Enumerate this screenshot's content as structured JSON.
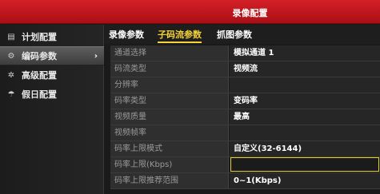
{
  "window": {
    "title": "录像配置"
  },
  "sidebar": {
    "items": [
      {
        "label": "计划配置",
        "icon": "calendar-icon",
        "glyph": "▤"
      },
      {
        "label": "编码参数",
        "icon": "gear-icon",
        "glyph": "⚙",
        "arrow": "›",
        "active": true
      },
      {
        "label": "高级配置",
        "icon": "settings-icon",
        "glyph": "✲"
      },
      {
        "label": "假日配置",
        "icon": "umbrella-icon",
        "glyph": "☂"
      }
    ]
  },
  "tabs": [
    {
      "label": "录像参数"
    },
    {
      "label": "子码流参数",
      "active": true
    },
    {
      "label": "抓图参数"
    }
  ],
  "form": {
    "rows": [
      {
        "label": "通道选择",
        "value": "模拟通道 1"
      },
      {
        "label": "码流类型",
        "value": "视频流"
      },
      {
        "label": "分辨率",
        "value": ""
      },
      {
        "label": "码率类型",
        "value": "变码率"
      },
      {
        "label": "视频质量",
        "value": "最高"
      },
      {
        "label": "视频帧率",
        "value": ""
      },
      {
        "label": "码率上限模式",
        "value": "自定义(32-6144)"
      },
      {
        "label": "码率上限(Kbps)",
        "value": ""
      },
      {
        "label": "码率上限推荐范围",
        "value": "0~1(Kbps)"
      }
    ]
  },
  "colors": {
    "titlebar": "#c8161d",
    "accent": "#f5d33a"
  }
}
